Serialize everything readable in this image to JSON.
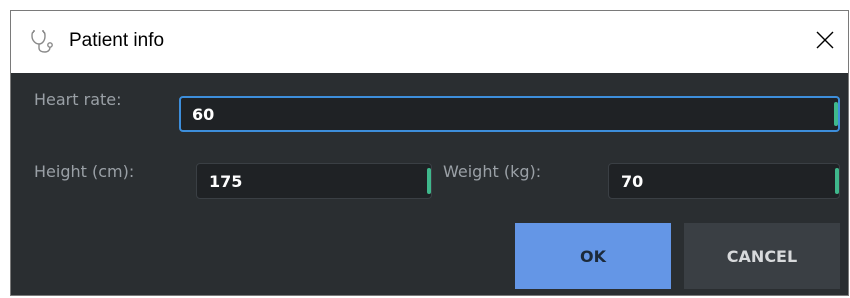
{
  "window": {
    "title": "Patient info",
    "app_icon": "stethoscope-icon",
    "close_icon": "close-icon"
  },
  "form": {
    "heart_rate": {
      "label": "Heart rate:",
      "value": "60"
    },
    "height": {
      "label": "Height (cm):",
      "value": "175"
    },
    "weight": {
      "label": "Weight (kg):",
      "value": "70"
    }
  },
  "buttons": {
    "ok_label": "OK",
    "cancel_label": "CANCEL"
  },
  "colors": {
    "background": "#2a2e31",
    "focus_border": "#3d8edb",
    "accent": "#3fb88c",
    "ok_button": "#6496e6",
    "cancel_button": "#3a3f44"
  }
}
